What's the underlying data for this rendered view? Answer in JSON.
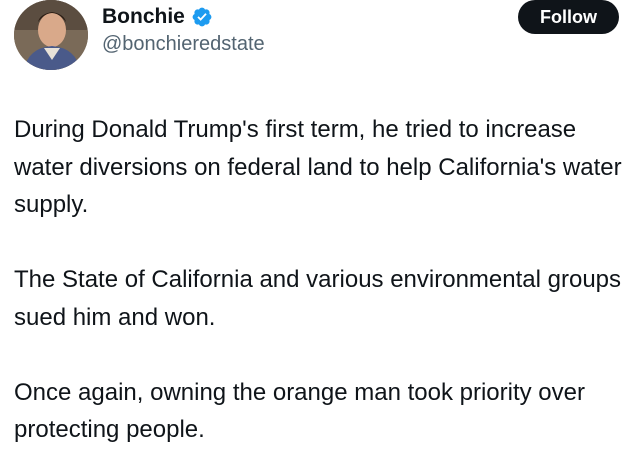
{
  "author": {
    "display_name": "Bonchie",
    "handle": "@bonchieredstate",
    "verified_color": "#1d9bf0"
  },
  "follow_button": {
    "label": "Follow",
    "bg_color": "#0f1419",
    "text_color": "#ffffff"
  },
  "tweet": {
    "paragraphs": [
      "During Donald Trump's first term, he tried to increase water diversions on federal land to help California's water supply.",
      "The State of California and various environmental groups sued him and won.",
      "Once again, owning the orange man took priority over protecting people."
    ]
  },
  "icons": {
    "verified": "verified-badge-icon"
  }
}
